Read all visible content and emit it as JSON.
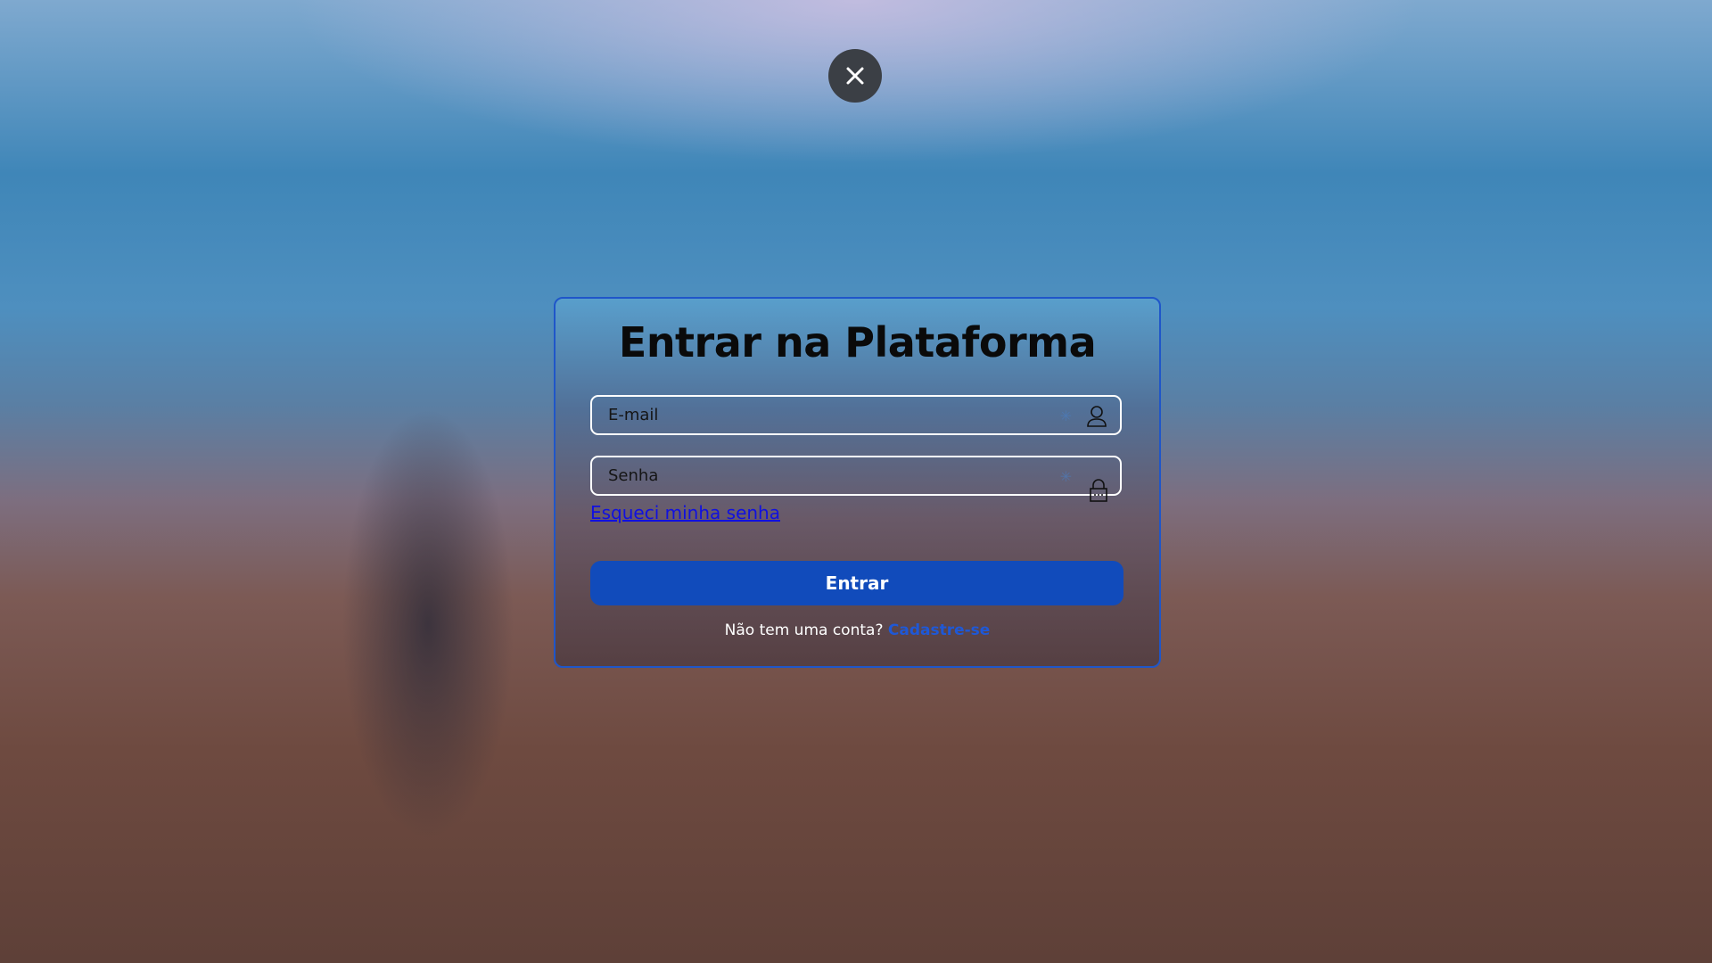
{
  "close_icon": "close-icon",
  "login": {
    "title": "Entrar na Plataforma",
    "email_placeholder": "E-mail",
    "password_placeholder": "Senha",
    "forgot_link": "Esqueci minha senha",
    "submit_label": "Entrar",
    "signup_prompt": "Não tem uma conta?",
    "signup_link": "Cadastre-se"
  },
  "colors": {
    "accent": "#114bbb",
    "card_border": "#1f56c9",
    "link": "#1010e0"
  }
}
